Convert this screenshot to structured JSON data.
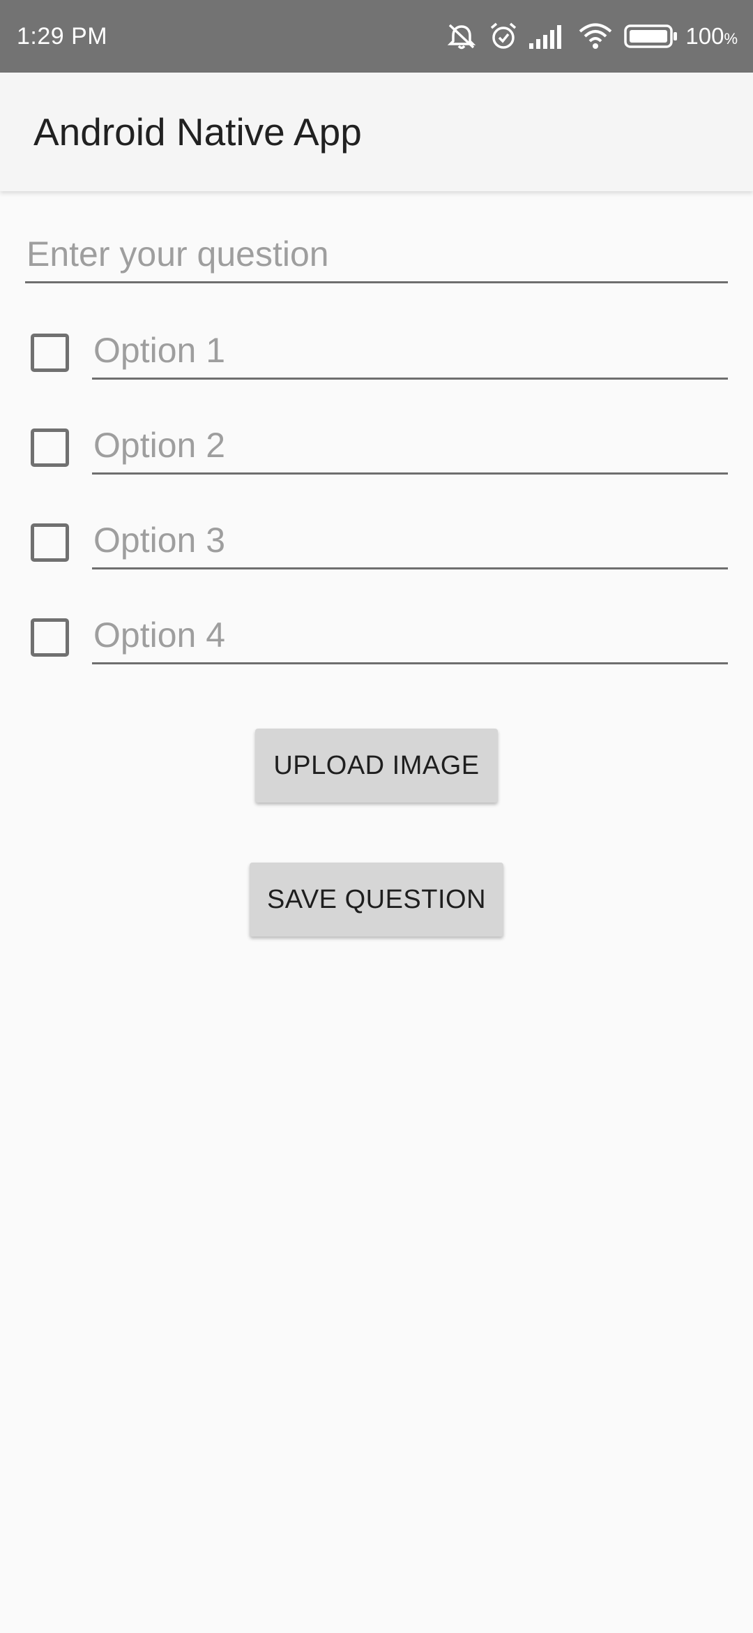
{
  "status_bar": {
    "time": "1:29 PM",
    "battery_percent": "100",
    "battery_suffix": "%",
    "icons": [
      "notifications-muted-icon",
      "alarm-icon",
      "cellular-signal-icon",
      "wifi-icon",
      "battery-icon"
    ]
  },
  "app_bar": {
    "title": "Android Native App"
  },
  "form": {
    "question_placeholder": "Enter your question",
    "options": [
      {
        "placeholder": "Option 1",
        "checked": false
      },
      {
        "placeholder": "Option 2",
        "checked": false
      },
      {
        "placeholder": "Option 3",
        "checked": false
      },
      {
        "placeholder": "Option 4",
        "checked": false
      }
    ],
    "upload_label": "UPLOAD IMAGE",
    "save_label": "SAVE QUESTION"
  }
}
